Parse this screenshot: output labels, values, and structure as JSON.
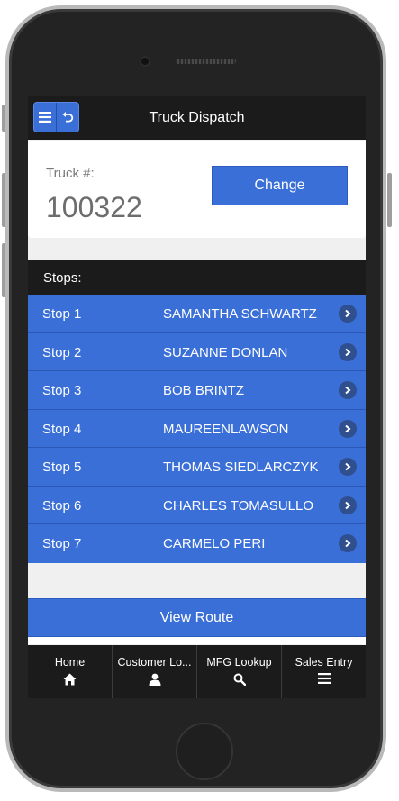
{
  "app": {
    "title": "Truck Dispatch"
  },
  "truck": {
    "label": "Truck #:",
    "number": "100322",
    "change_label": "Change"
  },
  "stops": {
    "header": "Stops:",
    "items": [
      {
        "stop": "Stop 1",
        "name": "SAMANTHA SCHWARTZ"
      },
      {
        "stop": "Stop 2",
        "name": "SUZANNE DONLAN"
      },
      {
        "stop": "Stop 3",
        "name": "BOB BRINTZ"
      },
      {
        "stop": "Stop 4",
        "name": "MAUREENLAWSON"
      },
      {
        "stop": "Stop 5",
        "name": "THOMAS SIEDLARCZYK"
      },
      {
        "stop": "Stop 6",
        "name": "CHARLES TOMASULLO"
      },
      {
        "stop": "Stop 7",
        "name": "CARMELO PERI"
      }
    ]
  },
  "actions": {
    "view_route_label": "View Route"
  },
  "nav": {
    "items": [
      {
        "label": "Home",
        "icon": "home-icon"
      },
      {
        "label": "Customer Lo...",
        "icon": "user-icon"
      },
      {
        "label": "MFG Lookup",
        "icon": "search-icon"
      },
      {
        "label": "Sales Entry",
        "icon": "menu-icon"
      }
    ]
  },
  "colors": {
    "accent": "#3a6fd8",
    "bar": "#1b1b1b",
    "background": "#f0f0f0"
  }
}
